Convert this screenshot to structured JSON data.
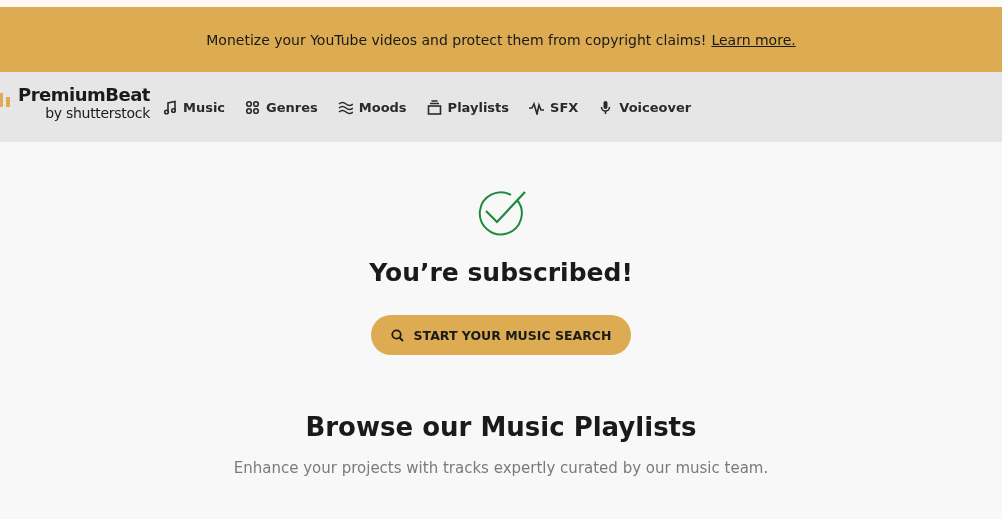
{
  "banner": {
    "message": "Monetize your YouTube videos and protect them from copyright claims!",
    "link": "Learn more."
  },
  "logo": {
    "name": "PremiumBeat",
    "byline": "by shutterstock"
  },
  "nav": [
    {
      "label": "Music",
      "kind": "note"
    },
    {
      "label": "Genres",
      "kind": "grid"
    },
    {
      "label": "Moods",
      "kind": "waves"
    },
    {
      "label": "Playlists",
      "kind": "stack"
    },
    {
      "label": "SFX",
      "kind": "pulse"
    },
    {
      "label": "Voiceover",
      "kind": "mic"
    }
  ],
  "confirmation": {
    "title": "You’re subscribed!",
    "button": "START YOUR MUSIC SEARCH"
  },
  "playlists": {
    "heading": "Browse our Music Playlists",
    "subtitle": "Enhance your projects with tracks expertly curated by our music team."
  }
}
